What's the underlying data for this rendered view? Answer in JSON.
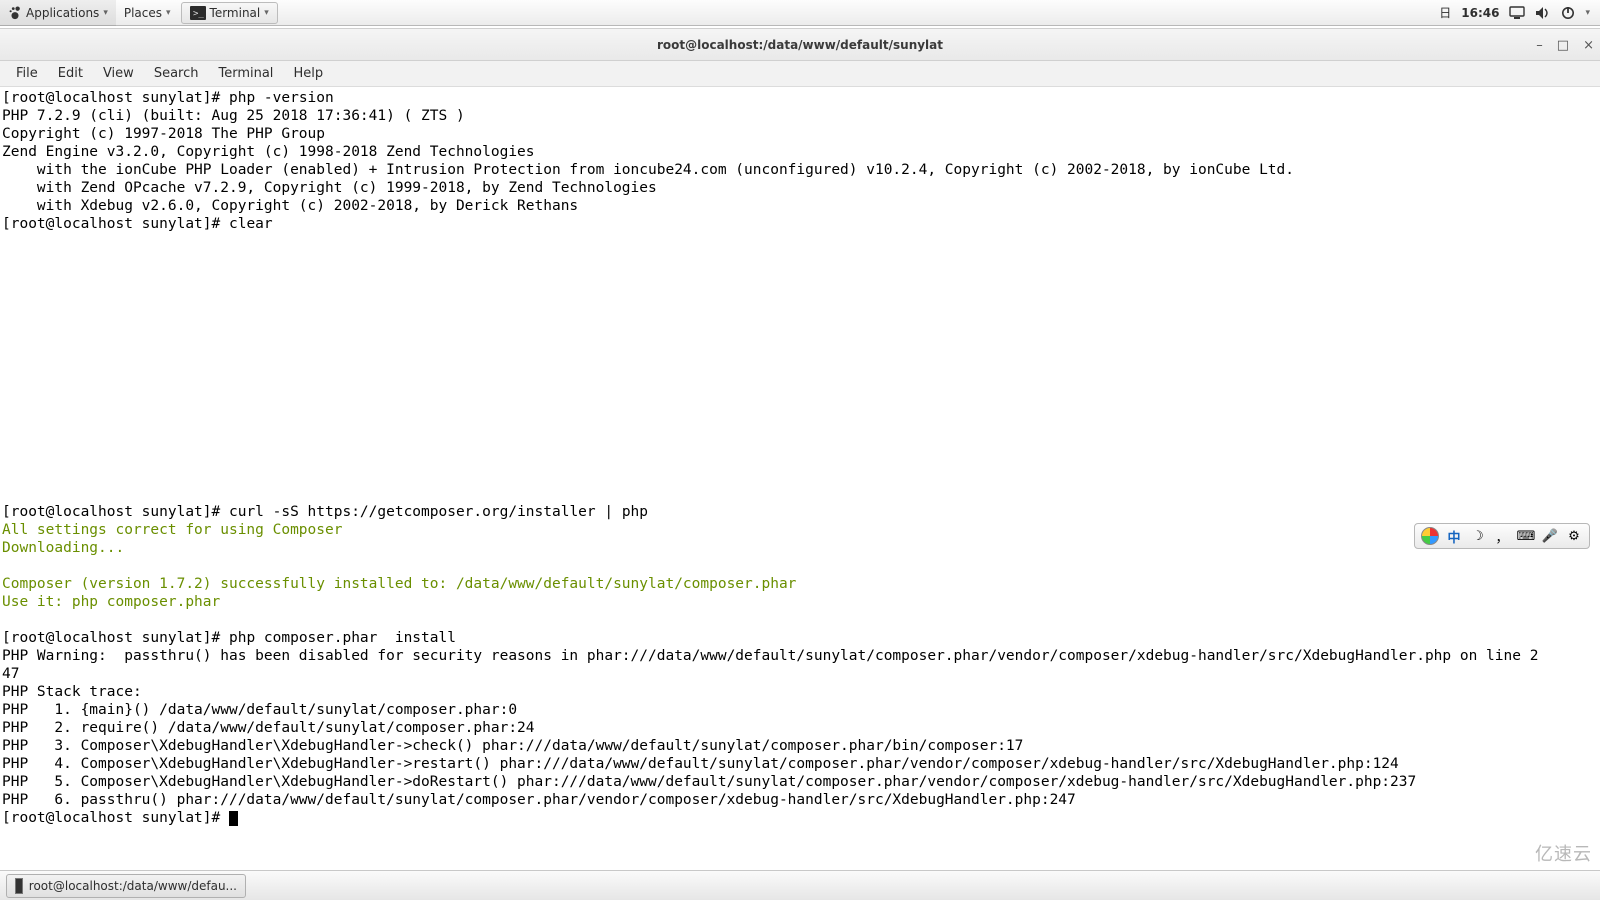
{
  "panel": {
    "applications": "Applications",
    "places": "Places",
    "terminal_btn": "Terminal",
    "date_glyph": "日",
    "clock": "16:46"
  },
  "window": {
    "title": "root@localhost:/data/www/default/sunylat",
    "menus": [
      "File",
      "Edit",
      "View",
      "Search",
      "Terminal",
      "Help"
    ],
    "minimize": "–",
    "maximize": "□",
    "close": "×"
  },
  "taskbar": {
    "item": "root@localhost:/data/www/defau..."
  },
  "watermark": "亿速云",
  "ime": {
    "zhong": "中",
    "moon": "☽",
    "comma": "，",
    "kbd": "⌨",
    "mic": "🎤",
    "gear": "⚙"
  },
  "terminal": {
    "prompt": "[root@localhost sunylat]# ",
    "cmd_version": "php -version",
    "version_lines": [
      "PHP 7.2.9 (cli) (built: Aug 25 2018 17:36:41) ( ZTS )",
      "Copyright (c) 1997-2018 The PHP Group",
      "Zend Engine v3.2.0, Copyright (c) 1998-2018 Zend Technologies",
      "    with the ionCube PHP Loader (enabled) + Intrusion Protection from ioncube24.com (unconfigured) v10.2.4, Copyright (c) 2002-2018, by ionCube Ltd.",
      "    with Zend OPcache v7.2.9, Copyright (c) 1999-2018, by Zend Technologies",
      "    with Xdebug v2.6.0, Copyright (c) 2002-2018, by Derick Rethans"
    ],
    "cmd_clear": "clear",
    "cmd_curl": "curl -sS https://getcomposer.org/installer | php",
    "green_lines": [
      "All settings correct for using Composer",
      "Downloading...",
      "",
      "Composer (version 1.7.2) successfully installed to: /data/www/default/sunylat/composer.phar",
      "Use it: php composer.phar"
    ],
    "cmd_install": "php composer.phar  install",
    "warn_lines": [
      "PHP Warning:  passthru() has been disabled for security reasons in phar:///data/www/default/sunylat/composer.phar/vendor/composer/xdebug-handler/src/XdebugHandler.php on line 2",
      "47",
      "PHP Stack trace:",
      "PHP   1. {main}() /data/www/default/sunylat/composer.phar:0",
      "PHP   2. require() /data/www/default/sunylat/composer.phar:24",
      "PHP   3. Composer\\XdebugHandler\\XdebugHandler->check() phar:///data/www/default/sunylat/composer.phar/bin/composer:17",
      "PHP   4. Composer\\XdebugHandler\\XdebugHandler->restart() phar:///data/www/default/sunylat/composer.phar/vendor/composer/xdebug-handler/src/XdebugHandler.php:124",
      "PHP   5. Composer\\XdebugHandler\\XdebugHandler->doRestart() phar:///data/www/default/sunylat/composer.phar/vendor/composer/xdebug-handler/src/XdebugHandler.php:237",
      "PHP   6. passthru() phar:///data/www/default/sunylat/composer.phar/vendor/composer/xdebug-handler/src/XdebugHandler.php:247"
    ]
  }
}
